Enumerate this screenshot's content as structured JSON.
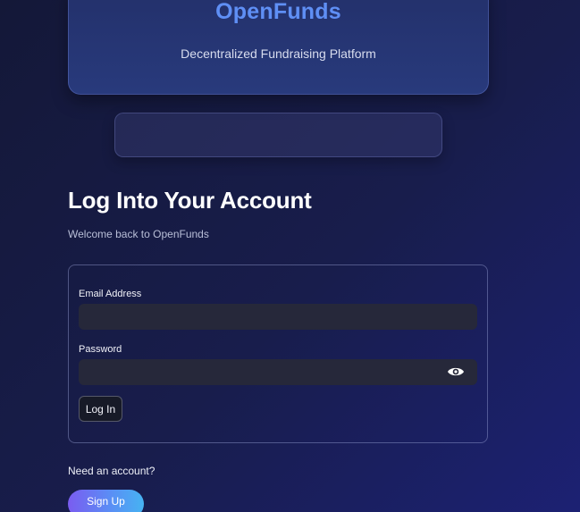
{
  "header": {
    "brand": "OpenFunds",
    "tagline": "Decentralized Fundraising Platform"
  },
  "login": {
    "title": "Log Into Your Account",
    "subtitle": "Welcome back to OpenFunds",
    "email_label": "Email Address",
    "email_value": "",
    "password_label": "Password",
    "password_value": "",
    "show_password_icon": "eye-icon",
    "login_button": "Log In"
  },
  "signup": {
    "prompt": "Need an account?",
    "button": "Sign Up"
  },
  "colors": {
    "brand": "#5f8ff5",
    "background": "#181d4c",
    "input_bg": "#26283a"
  }
}
